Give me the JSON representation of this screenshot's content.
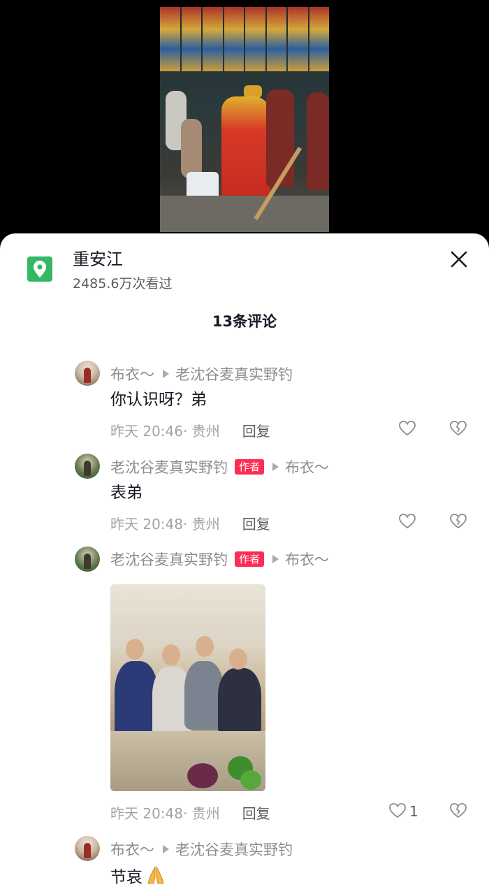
{
  "location": {
    "name": "重安江",
    "views": "2485.6万次看过",
    "icon": "location-pin-icon",
    "icon_color": "#35b865"
  },
  "comments_header": {
    "title": "13条评论"
  },
  "comments": [
    {
      "user": "布衣～",
      "is_author": false,
      "reply_to": "老沈谷麦真实野钓",
      "text": "你认识呀？弟",
      "time_location": "昨天 20:46· 贵州",
      "reply_label": "回复",
      "likes": ""
    },
    {
      "user": "老沈谷麦真实野钓",
      "is_author": true,
      "author_badge": "作者",
      "reply_to": "布衣～",
      "text": "表弟",
      "time_location": "昨天 20:48· 贵州",
      "reply_label": "回复",
      "likes": ""
    },
    {
      "user": "老沈谷麦真实野钓",
      "is_author": true,
      "author_badge": "作者",
      "reply_to": "布衣～",
      "text": "",
      "has_image": true,
      "time_location": "昨天 20:48· 贵州",
      "reply_label": "回复",
      "likes": "1"
    },
    {
      "user": "布衣～",
      "is_author": false,
      "reply_to": "老沈谷麦真实野钓",
      "text": "节哀",
      "time_location": "",
      "reply_label": "",
      "likes": ""
    }
  ],
  "colors": {
    "accent_red": "#fe2c55",
    "text_primary": "#161823",
    "text_secondary": "#8b8d93"
  }
}
